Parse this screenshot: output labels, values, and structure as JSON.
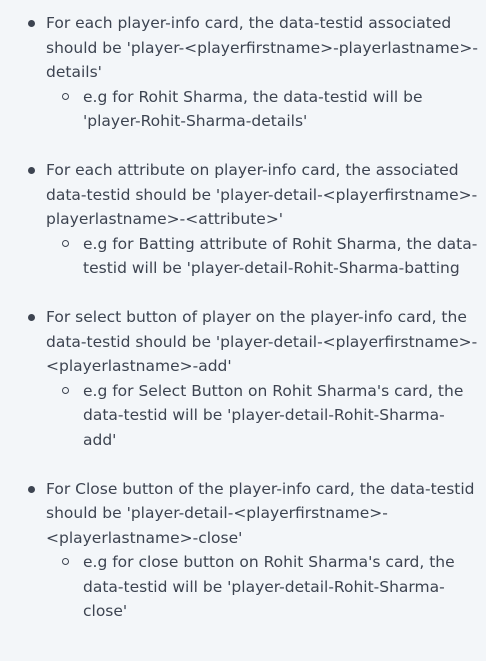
{
  "items": [
    {
      "text": "For each player-info card, the data-testid associated should be 'player-<playerfirstname>-playerlastname>-details'",
      "sub": "e.g for Rohit Sharma, the data-testid will be 'player-Rohit-Sharma-details'"
    },
    {
      "text": "For each attribute on player-info card, the associated data-testid should be 'player-detail-<playerfirstname>-playerlastname>-<attribute>'",
      "sub": "e.g for Batting attribute of Rohit Sharma, the data-testid will be 'player-detail-Rohit-Sharma-batting"
    },
    {
      "text": "For select button of player on the player-info card, the data-testid should be 'player-detail-<playerfirstname>-<playerlastname>-add'",
      "sub": "e.g for Select Button on Rohit Sharma's card, the data-testid will be 'player-detail-Rohit-Sharma-add'"
    },
    {
      "text": "For Close button of the player-info card, the data-testid should be 'player-detail-<playerfirstname>-<playerlastname>-close'",
      "sub": "e.g for close button on Rohit Sharma's card, the data-testid will be 'player-detail-Rohit-Sharma-close'"
    }
  ]
}
